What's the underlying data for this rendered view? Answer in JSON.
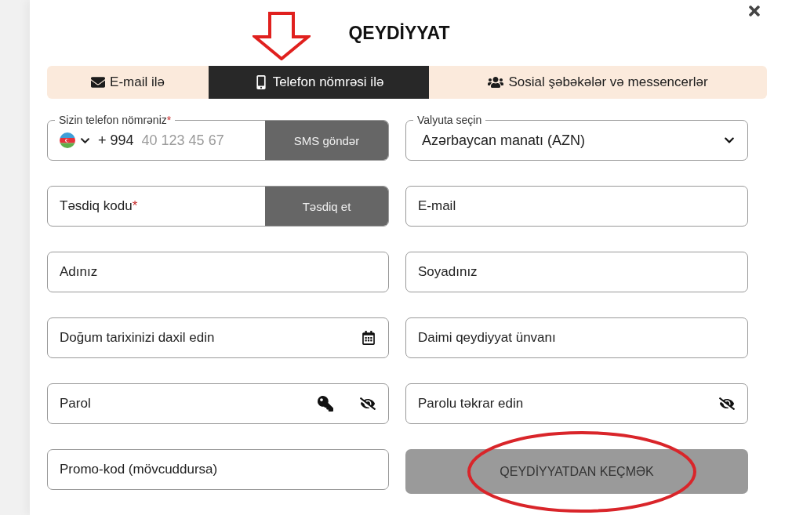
{
  "title": "QEYDİYYAT",
  "tabs": [
    {
      "label": "E-mail ilə",
      "kind": "email",
      "selected": false
    },
    {
      "label": "Telefon nömrəsi ilə",
      "kind": "phone",
      "selected": true
    },
    {
      "label": "Sosial şəbəkələr və messencerlər",
      "kind": "social",
      "selected": false
    }
  ],
  "fields": [
    {
      "kind": "phone",
      "label": "Sizin telefon nömrəniz",
      "mark": "*",
      "code": "+ 994",
      "placeholder": "40 123 45 67",
      "button": "SMS göndər"
    },
    {
      "kind": "select",
      "label": "Valyuta seçin",
      "value": "Azərbaycan manatı (AZN)"
    },
    {
      "kind": "code",
      "label": "Təsdiq kodu",
      "mark": "*",
      "button": "Təsdiq et"
    },
    {
      "kind": "text",
      "label": "E-mail"
    },
    {
      "kind": "text",
      "label": "Adınız"
    },
    {
      "kind": "text",
      "label": "Soyadınız"
    },
    {
      "kind": "date",
      "label": "Doğum tarixinizi daxil edin"
    },
    {
      "kind": "text",
      "label": "Daimi qeydiyyat ünvanı"
    },
    {
      "kind": "password",
      "label": "Parol",
      "key": true
    },
    {
      "kind": "password",
      "label": "Parolu təkrar edin",
      "key": false
    },
    {
      "kind": "text",
      "label": "Promo-kod (mövcuddursa)"
    },
    {
      "kind": "submit",
      "label": "QEYDİYYATDAN KEÇMƏK",
      "disabled": true
    }
  ]
}
